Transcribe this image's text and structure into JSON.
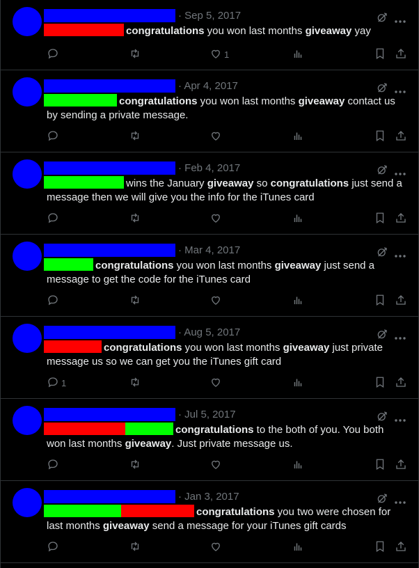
{
  "colors": {
    "bg": "#000000",
    "text": "#e7e9ea",
    "muted": "#71767b",
    "divider": "#2f3336",
    "redaction_name": "#0000ff",
    "redaction_red": "#ff0000",
    "redaction_green": "#00ff00"
  },
  "tweets": [
    {
      "date": "· Sep 5, 2017",
      "mentions": [
        "red"
      ],
      "segments": [
        [
          "b",
          "congratulations"
        ],
        [
          "t",
          " you won last months "
        ],
        [
          "b",
          "giveaway"
        ],
        [
          "t",
          " yay"
        ]
      ],
      "reply_count": "",
      "like_count": "1"
    },
    {
      "date": "· Apr 4, 2017",
      "mentions": [
        "green"
      ],
      "segments": [
        [
          "b",
          "congratulations"
        ],
        [
          "t",
          " you won last months "
        ],
        [
          "b",
          "giveaway"
        ],
        [
          "t",
          " contact us by sending a private message."
        ]
      ],
      "reply_count": "",
      "like_count": ""
    },
    {
      "date": "· Feb 4, 2017",
      "mentions": [
        "green"
      ],
      "segments": [
        [
          "t",
          "wins the January "
        ],
        [
          "b",
          "giveaway"
        ],
        [
          "t",
          " so "
        ],
        [
          "b",
          "congratulations"
        ],
        [
          "t",
          " just send a message then we will give you the info for the iTunes card"
        ]
      ],
      "reply_count": "",
      "like_count": ""
    },
    {
      "date": "· Mar 4, 2017",
      "mentions": [
        "green"
      ],
      "segments": [
        [
          "b",
          "congratulations"
        ],
        [
          "t",
          " you won last months "
        ],
        [
          "b",
          "giveaway"
        ],
        [
          "t",
          " just send a message to get the code for the iTunes card"
        ]
      ],
      "reply_count": "",
      "like_count": ""
    },
    {
      "date": "· Aug 5, 2017",
      "mentions": [
        "red"
      ],
      "segments": [
        [
          "b",
          "congratulations"
        ],
        [
          "t",
          " you won last months "
        ],
        [
          "b",
          "giveaway"
        ],
        [
          "t",
          " just private message us so we can get you the iTunes gift card"
        ]
      ],
      "reply_count": "1",
      "like_count": ""
    },
    {
      "date": "· Jul 5, 2017",
      "mentions": [
        "red",
        "green"
      ],
      "segments": [
        [
          "b",
          "congratulations"
        ],
        [
          "t",
          " to the both of you. You both won last months "
        ],
        [
          "b",
          "giveaway"
        ],
        [
          "t",
          ". Just private message us."
        ]
      ],
      "reply_count": "",
      "like_count": ""
    },
    {
      "date": "· Jan 3, 2017",
      "mentions": [
        "green",
        "red"
      ],
      "segments": [
        [
          "b",
          "congratulations"
        ],
        [
          "t",
          " you two were chosen for last months "
        ],
        [
          "b",
          "giveaway"
        ],
        [
          "t",
          " send a message for your iTunes gift cards"
        ]
      ],
      "reply_count": "",
      "like_count": ""
    }
  ]
}
